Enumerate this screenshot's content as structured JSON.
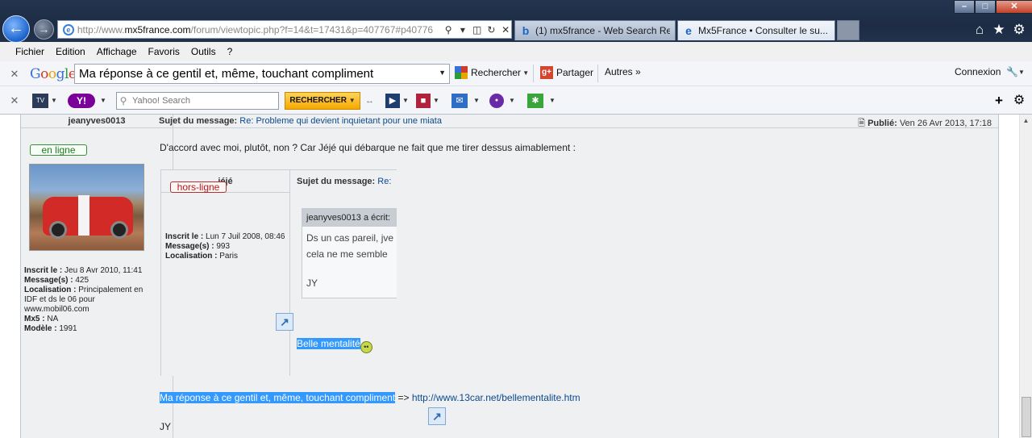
{
  "browser": {
    "url_prefix": "http://www.",
    "url_domain": "mx5france.com",
    "url_rest": "/forum/viewtopic.php?f=14&t=17431&p=407767#p40776",
    "tabs": [
      {
        "label": "(1) mx5france - Web Search Re..."
      },
      {
        "label": "Mx5France • Consulter le su..."
      }
    ]
  },
  "menu": [
    "Fichier",
    "Edition",
    "Affichage",
    "Favoris",
    "Outils",
    "?"
  ],
  "google_toolbar": {
    "logo": "Google",
    "query": "Ma réponse à ce gentil et, même, touchant compliment",
    "search_label": "Rechercher",
    "share_label": "Partager",
    "more_label": "Autres",
    "login_label": "Connexion"
  },
  "yahoo_toolbar": {
    "search_placeholder": "Yahoo! Search",
    "search_button": "RECHERCHER"
  },
  "post": {
    "author": "jeanyves0013",
    "subject_label": "Sujet du message:",
    "subject": "Re: Probleme qui devient inquietant pour une miata",
    "published_label": "Publié:",
    "published": "Ven 26 Avr 2013, 17:18",
    "status": "en ligne",
    "profile": {
      "registered_label": "Inscrit le :",
      "registered": "Jeu 8 Avr 2010, 11:41",
      "messages_label": "Message(s) :",
      "messages": "425",
      "location_label": "Localisation :",
      "location": "Principalement en IDF et ds le 06 pour www.mobil06.com",
      "mx5_label": "Mx5 :",
      "mx5": "NA",
      "model_label": "Modèle :",
      "model": "1991"
    },
    "intro": "D'accord avec moi, plutôt, non ? Car Jéjé qui débarque ne fait que me tirer dessus aimablement :",
    "quote": {
      "author": "jéjé",
      "subject_label": "Sujet du message:",
      "subject": "Re:",
      "status": "hors-ligne",
      "registered_label": "Inscrit le :",
      "registered": "Lun 7 Juil 2008, 08:46",
      "messages_label": "Message(s) :",
      "messages": "993",
      "location_label": "Localisation :",
      "location": "Paris",
      "inner_header": "jeanyves0013 a écrit:",
      "inner_line1": "Ds un cas pareil, jve",
      "inner_line2": "cela ne me semble",
      "inner_sig": "JY",
      "reply": "Belle mentalité"
    },
    "reply_highlight": "Ma réponse à ce gentil et, même, touchant compliment",
    "reply_arrow": " => ",
    "reply_url": "http://www.13car.net/bellementalite.htm",
    "signature": "JY"
  }
}
